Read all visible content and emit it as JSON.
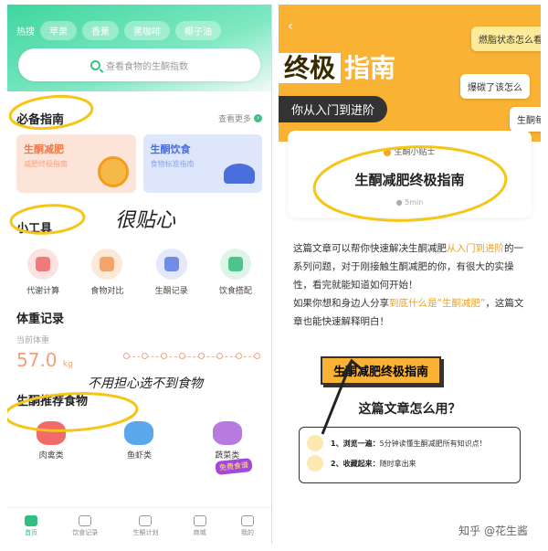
{
  "left": {
    "hot": {
      "label": "热搜",
      "chips": [
        "苹果",
        "香蕉",
        "黑咖啡",
        "椰子油"
      ]
    },
    "search_placeholder": "查看食物的生酮指数",
    "guide": {
      "title": "必备指南",
      "more": "查看更多",
      "cards": [
        {
          "title": "生酮减肥",
          "sub": "减肥终极指南"
        },
        {
          "title": "生酮饮食",
          "sub": "食物标准指南"
        }
      ]
    },
    "tools": {
      "title": "小工具",
      "items": [
        {
          "label": "代谢计算",
          "color": "#f07a7a"
        },
        {
          "label": "食物对比",
          "color": "#f3a468"
        },
        {
          "label": "生酮记录",
          "color": "#6f8de6"
        },
        {
          "label": "饮食搭配",
          "color": "#4cc58d"
        }
      ]
    },
    "weight": {
      "title": "体重记录",
      "sub": "当前体重",
      "value": "57.0",
      "unit": "kg"
    },
    "foods": {
      "title": "生酮推荐食物",
      "items": [
        "肉禽类",
        "鱼虾类",
        "蔬菜类"
      ],
      "badge": "免费食谱"
    },
    "tabs": [
      "首页",
      "饮食记录",
      "生酮计划",
      "商城",
      "我的"
    ],
    "active_tab": 0,
    "notes": {
      "note1": "很贴心",
      "note2": "不用担心选不到食物"
    }
  },
  "right": {
    "banner": {
      "title_part1": "终极",
      "title_part2": "指南",
      "pill": "你从入门到进阶",
      "tags": [
        "燃脂状态怎么看",
        "爆碳了该怎么",
        "生酮每"
      ]
    },
    "tip": {
      "label": "生酮小贴士",
      "title": "生酮减肥终极指南",
      "time": "5min"
    },
    "article": {
      "p1_before": "这篇文章可以帮你快速解决生酮减肥",
      "p1_hl": "从入门到进阶",
      "p1_after": "的一系列问题，对于刚接触生酮减肥的你，有很大的实操性，看完就能知道如何开始！",
      "p2_before": "如果你想和身边人分享",
      "p2_hl": "到底什么是“生酮减肥”",
      "p2_after": "，这篇文章也能快速解释明白！"
    },
    "section": {
      "pill": "生酮减肥终极指南",
      "how": "这篇文章怎么用？",
      "steps": [
        {
          "bold": "1、浏览一遍：",
          "text": "5分钟读懂生酮减肥所有知识点！"
        },
        {
          "bold": "2、收藏起来：",
          "text": "随时拿出来"
        }
      ]
    },
    "watermark": "知乎 @花生酱"
  }
}
